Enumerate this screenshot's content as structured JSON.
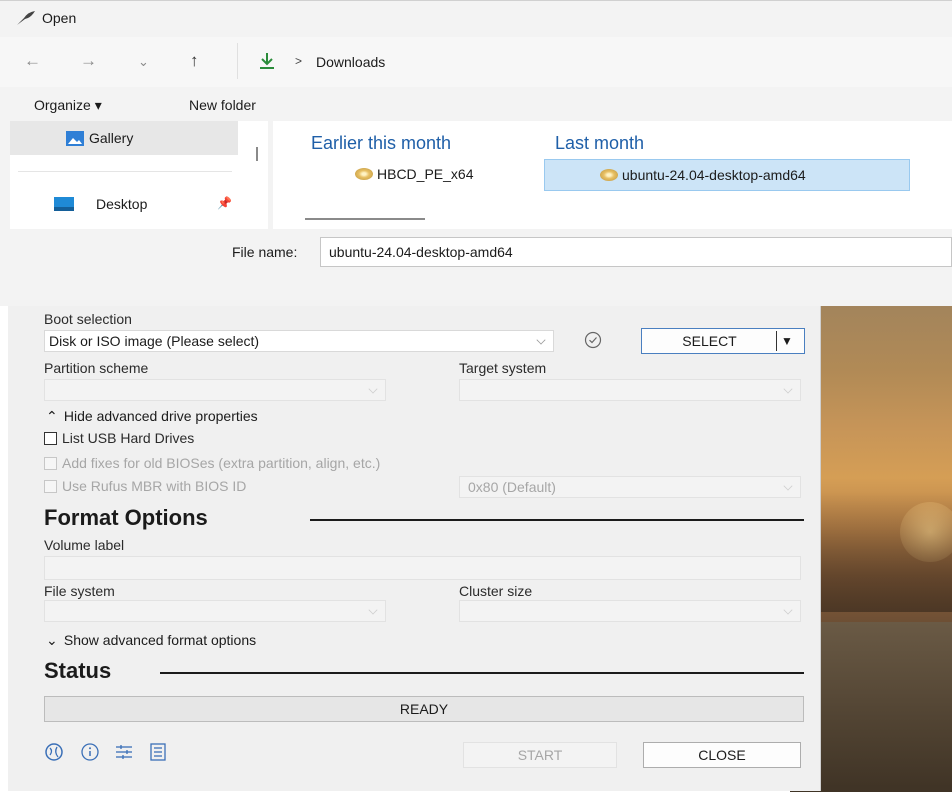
{
  "open_dialog": {
    "title": "Open",
    "breadcrumb": {
      "separator": ">",
      "current": "Downloads"
    },
    "commands": {
      "organize": "Organize ▾",
      "new_folder": "New folder"
    },
    "nav_pane": {
      "items": [
        {
          "label": "Gallery"
        },
        {
          "label": "Desktop"
        }
      ]
    },
    "groups": [
      {
        "header": "Earlier this month",
        "file": "HBCD_PE_x64"
      },
      {
        "header": "Last month",
        "file": "ubuntu-24.04-desktop-amd64"
      }
    ],
    "file_name_label": "File name:",
    "file_name_value": "ubuntu-24.04-desktop-amd64"
  },
  "rufus": {
    "boot_selection_label": "Boot selection",
    "boot_selection_value": "Disk or ISO image (Please select)",
    "select_button": "SELECT",
    "partition_scheme_label": "Partition scheme",
    "target_system_label": "Target system",
    "hide_advanced_drive": "Hide advanced drive properties",
    "list_usb_hard_drives": "List USB Hard Drives",
    "add_fixes": "Add fixes for old BIOSes (extra partition, align, etc.)",
    "use_rufus_mbr": "Use Rufus MBR with BIOS ID",
    "bios_id_value": "0x80 (Default)",
    "format_options_title": "Format Options",
    "volume_label": "Volume label",
    "file_system_label": "File system",
    "cluster_size_label": "Cluster size",
    "show_advanced_format": "Show advanced format options",
    "status_title": "Status",
    "status_text": "READY",
    "start_button": "START",
    "close_button": "CLOSE"
  },
  "colors": {
    "accent": "#1f5fa8",
    "selection": "#cce4f7",
    "dialog_bg": "#f0f0f0"
  }
}
